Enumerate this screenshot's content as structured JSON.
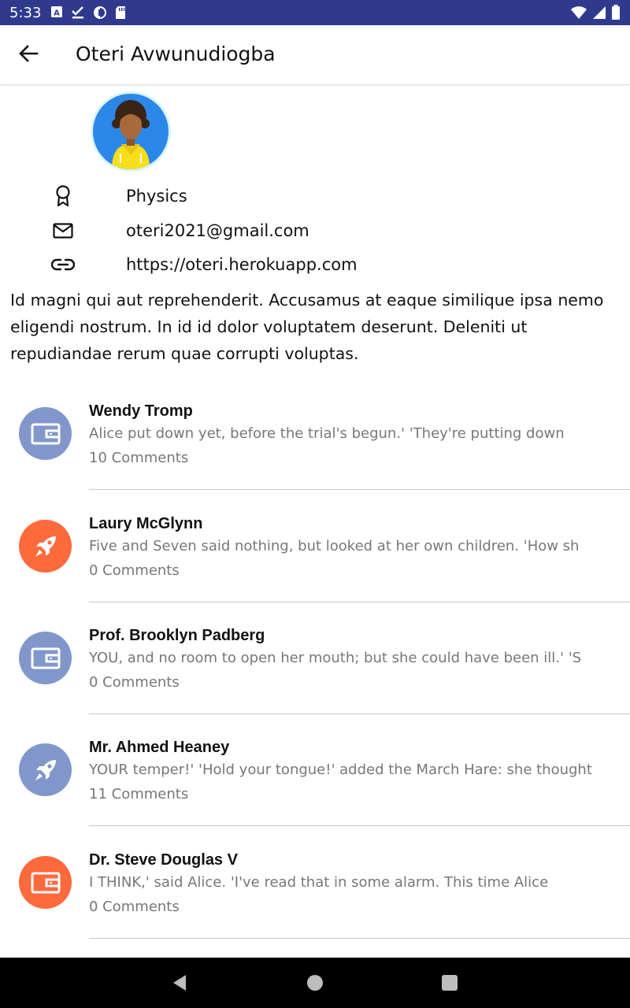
{
  "status_bar": {
    "time": "5:33",
    "left_icons": [
      "keyboard-a-icon",
      "checkmark-download-icon",
      "clock-circle-icon",
      "sd-card-icon"
    ],
    "right_icons": [
      "wifi-icon",
      "signal-icon",
      "battery-icon"
    ]
  },
  "app_bar": {
    "back_icon": "arrow-left-icon",
    "title": "Oteri Avwunudiogba"
  },
  "profile": {
    "avatar_icon": "person-avatar-icon",
    "subject": "Physics",
    "email": "oteri2021@gmail.com",
    "website": "https://oteri.herokuapp.com",
    "bio": "Id magni qui aut reprehenderit. Accusamus at eaque similique ipsa nemo eligendi nostrum. In id id dolor voluptatem deserunt. Deleniti ut repudiandae rerum quae corrupti voluptas."
  },
  "posts": [
    {
      "author": "Wendy Tromp",
      "excerpt": "Alice put down yet, before the trial's begun.' 'They're putting down",
      "comments": "10 Comments",
      "icon": "wallet-icon",
      "color": "#8197cc"
    },
    {
      "author": "Laury McGlynn",
      "excerpt": "Five and Seven said nothing, but looked at her own children. 'How sh",
      "comments": "0 Comments",
      "icon": "rocket-icon",
      "color": "#ff6a3d"
    },
    {
      "author": "Prof. Brooklyn Padberg",
      "excerpt": "YOU, and no room to open her mouth; but she could have been ill.' 'S",
      "comments": "0 Comments",
      "icon": "wallet-icon",
      "color": "#8197cc"
    },
    {
      "author": "Mr. Ahmed Heaney",
      "excerpt": "YOUR temper!' 'Hold your tongue!' added the March Hare: she thought",
      "comments": "11 Comments",
      "icon": "rocket-icon",
      "color": "#8197cc"
    },
    {
      "author": "Dr. Steve Douglas V",
      "excerpt": "I THINK,' said Alice. 'I've read that in some alarm. This time Alice",
      "comments": "0 Comments",
      "icon": "wallet-icon",
      "color": "#ff6a3d"
    }
  ],
  "nav": {
    "back_icon": "triangle-back-icon",
    "home_icon": "circle-home-icon",
    "recents_icon": "square-recents-icon"
  }
}
